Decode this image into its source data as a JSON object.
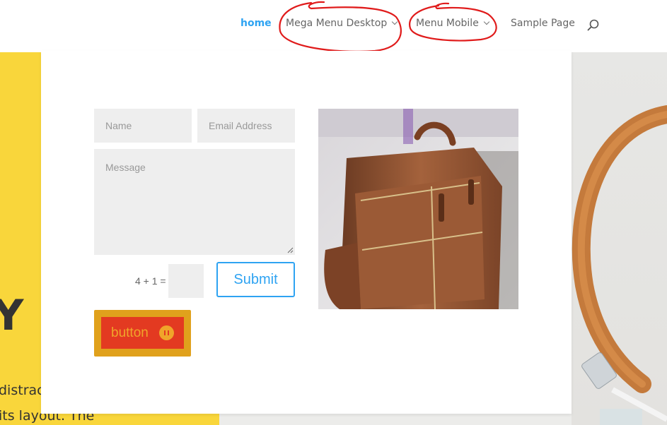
{
  "nav": {
    "items": [
      {
        "label": "home",
        "active": true
      },
      {
        "label": "Mega Menu Desktop",
        "has_dropdown": true
      },
      {
        "label": "Menu Mobile",
        "has_dropdown": true
      },
      {
        "label": "Sample Page"
      }
    ],
    "search_icon": "search-icon"
  },
  "form": {
    "name_placeholder": "Name",
    "email_placeholder": "Email Address",
    "message_placeholder": "Message",
    "captcha_label": "4 + 1 =",
    "submit_label": "Submit"
  },
  "promo_button": {
    "label": "button",
    "icon": "pause-circle-icon"
  },
  "hero": {
    "letter": "Y",
    "line1": "distrac",
    "line2": "its layout. The"
  },
  "colors": {
    "accent": "#2ea3f2",
    "yellow_panel": "#f9d63b",
    "annotation_red": "#e01b1b",
    "button_outer": "#e0a11c",
    "button_inner": "#e33a21",
    "button_text": "#f0a52a"
  }
}
